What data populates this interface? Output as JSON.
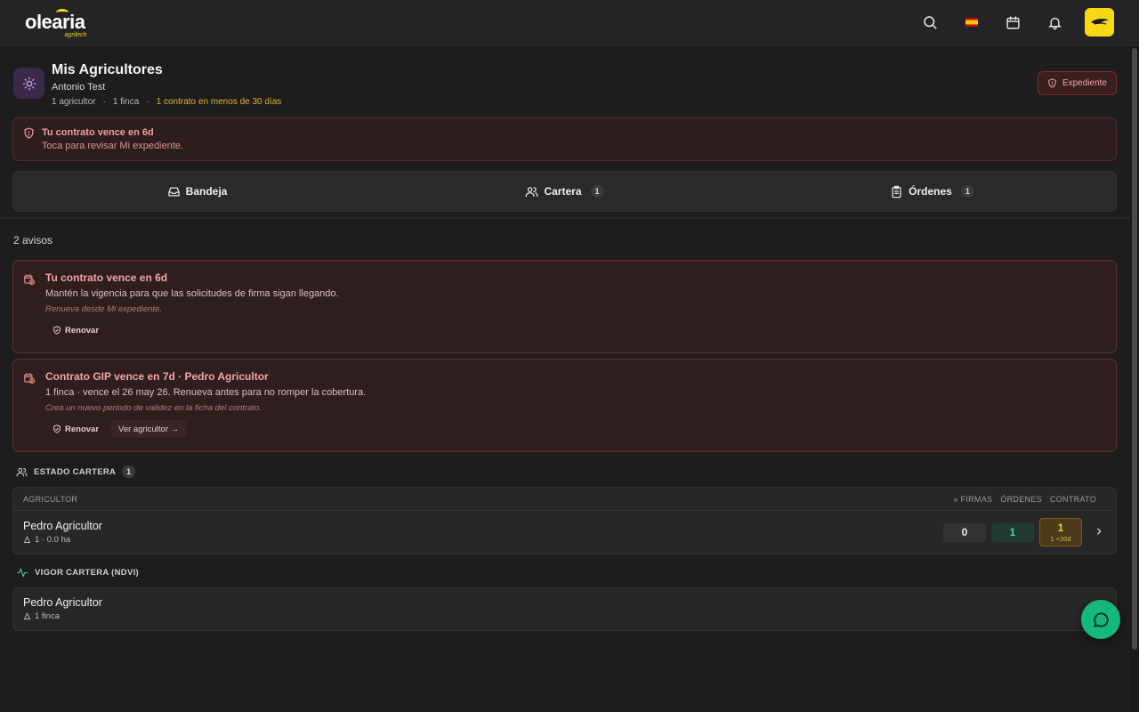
{
  "brand": {
    "name": "olearia",
    "tagline": "agritech"
  },
  "topbar": {
    "icons": [
      "search-icon",
      "flag-es-icon",
      "calendar-icon",
      "bell-icon",
      "user-avatar-icon"
    ]
  },
  "header": {
    "title": "Mis Agricultores",
    "user": "Antonio Test",
    "meta_farmers": "1 agricultor",
    "meta_farms": "1 finca",
    "meta_contracts": "1 contrato en menos de 30 días",
    "expediente_button": "Expediente"
  },
  "banner": {
    "title": "Tu contrato vence en 6d",
    "subtitle": "Toca para revisar Mi expediente."
  },
  "tabs": [
    {
      "label": "Bandeja",
      "icon": "inbox-icon",
      "count": ""
    },
    {
      "label": "Cartera",
      "icon": "users-icon",
      "count": "1"
    },
    {
      "label": "Órdenes",
      "icon": "clipboard-icon",
      "count": "1"
    }
  ],
  "notices": {
    "count_label": "2 avisos",
    "items": [
      {
        "title": "Tu contrato vence en 6d",
        "body": "Mantén la vigencia para que las solicitudes de firma sigan llegando.",
        "hint": "Renueva desde Mi expediente.",
        "renew_label": "Renovar",
        "link_label": ""
      },
      {
        "title": "Contrato GIP vence en 7d · Pedro Agricultor",
        "body": "1 finca · vence el 26 may 26. Renueva antes para no romper la cobertura.",
        "hint": "Crea un nuevo periodo de validez en la ficha del contrato.",
        "renew_label": "Renovar",
        "link_label": "Ver agricultor →"
      }
    ]
  },
  "portfolio": {
    "section_label": "ESTADO CARTERA",
    "section_count": "1",
    "col_farmer": "AGRICULTOR",
    "col_signatures": "» FIRMAS",
    "col_orders": "ÓRDENES",
    "col_contract": "CONTRATO",
    "rows": [
      {
        "name": "Pedro Agricultor",
        "sub": "1 · 0.0 ha",
        "signatures": "0",
        "orders": "1",
        "contract": "1",
        "contract_sub": "1 <30d"
      }
    ]
  },
  "ndvi": {
    "section_label": "VIGOR CARTERA (NDVI)",
    "name": "Pedro Agricultor",
    "sub": "1 finca"
  },
  "colors": {
    "accent_yellow": "#f6d915",
    "danger": "#f2a4a4",
    "success": "#13b87a",
    "warning": "#e3b232"
  }
}
